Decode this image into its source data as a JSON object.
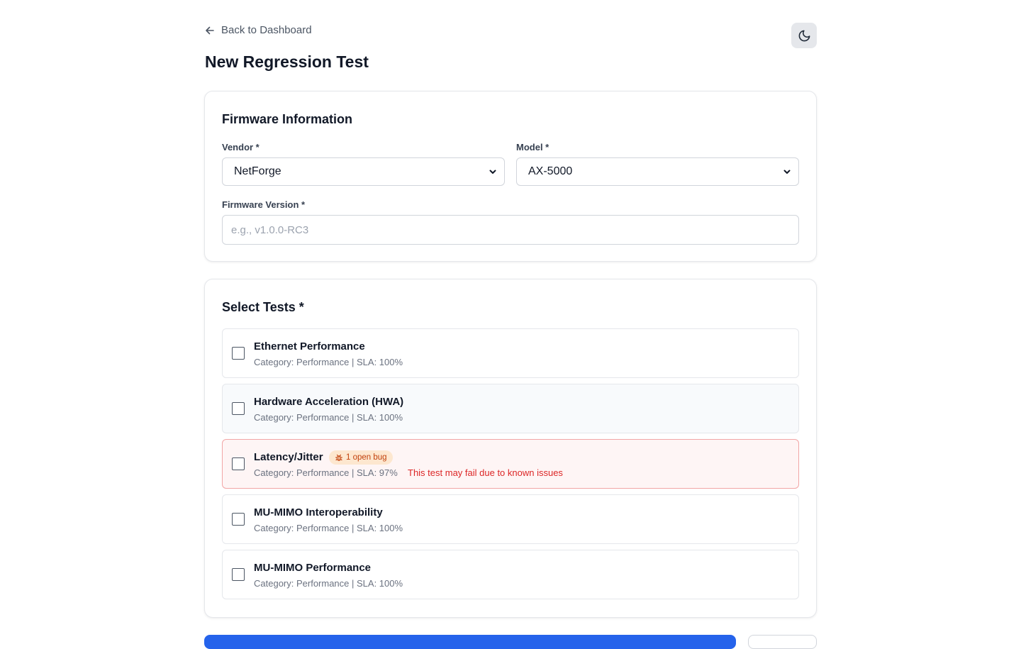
{
  "header": {
    "back_label": "Back to Dashboard",
    "page_title": "New Regression Test"
  },
  "firmware_card": {
    "title": "Firmware Information",
    "vendor_label": "Vendor *",
    "vendor_value": "NetForge",
    "model_label": "Model *",
    "model_value": "AX-5000",
    "version_label": "Firmware Version *",
    "version_value": "",
    "version_placeholder": "e.g., v1.0.0-RC3"
  },
  "tests_card": {
    "title": "Select Tests *",
    "items": [
      {
        "name": "Ethernet Performance",
        "meta": "Category: Performance | SLA: 100%",
        "checked": false
      },
      {
        "name": "Hardware Acceleration (HWA)",
        "meta": "Category: Performance | SLA: 100%",
        "checked": false
      },
      {
        "name": "Latency/Jitter",
        "meta": "Category: Performance | SLA: 97%",
        "checked": false,
        "badge": "1 open bug",
        "warning": "This test may fail due to known issues"
      },
      {
        "name": "MU-MIMO Interoperability",
        "meta": "Category: Performance | SLA: 100%",
        "checked": false
      },
      {
        "name": "MU-MIMO Performance",
        "meta": "Category: Performance | SLA: 100%",
        "checked": false
      }
    ]
  },
  "colors": {
    "primary": "#2563eb",
    "danger": "#dc2626",
    "badge_bg": "#fde7cf",
    "badge_text": "#c2410c",
    "warning_bg": "#fef5f5"
  },
  "icons": {
    "back": "arrow-left-icon",
    "theme": "moon-icon",
    "select": "chevron-down-icon",
    "bug": "bug-icon"
  }
}
